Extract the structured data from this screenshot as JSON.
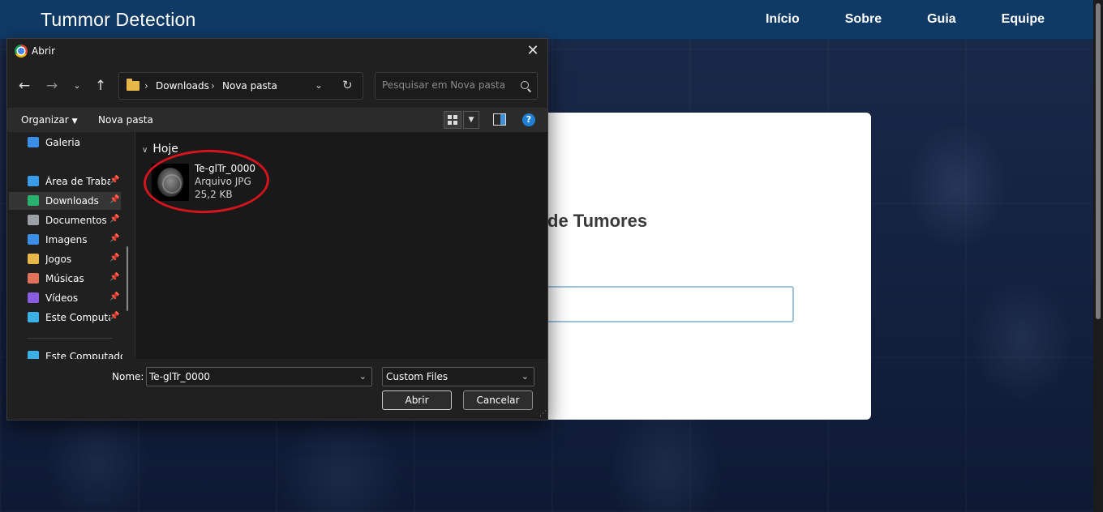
{
  "page": {
    "brand": "Tummor Detection",
    "nav": [
      "Início",
      "Sobre",
      "Guia",
      "Equipe"
    ],
    "card_title": "de Tumores"
  },
  "dialog": {
    "title": "Abrir",
    "breadcrumb": [
      "Downloads",
      "Nova pasta"
    ],
    "search_placeholder": "Pesquisar em Nova pasta",
    "toolbar": {
      "organize": "Organizar",
      "new_folder": "Nova pasta"
    },
    "nav_items": [
      {
        "label": "Galeria",
        "icon": "gallery-icon",
        "pinned": false,
        "color": "#3a8ee6"
      },
      {
        "label": "Área de Trabalho",
        "icon": "desktop-icon",
        "pinned": true,
        "color": "#3a9be8"
      },
      {
        "label": "Downloads",
        "icon": "download-icon",
        "pinned": true,
        "color": "#27b36d"
      },
      {
        "label": "Documentos",
        "icon": "document-icon",
        "pinned": true,
        "color": "#9aa0a6"
      },
      {
        "label": "Imagens",
        "icon": "image-icon",
        "pinned": true,
        "color": "#3a8ee6"
      },
      {
        "label": "Jogos",
        "icon": "folder-icon",
        "pinned": true,
        "color": "#e8b74a"
      },
      {
        "label": "Músicas",
        "icon": "music-icon",
        "pinned": true,
        "color": "#e0725a"
      },
      {
        "label": "Vídeos",
        "icon": "video-icon",
        "pinned": true,
        "color": "#8a5ce0"
      },
      {
        "label": "Este Computador",
        "icon": "computer-icon",
        "pinned": true,
        "color": "#3ab0e6"
      },
      {
        "label": "Este Computador",
        "icon": "computer-icon",
        "pinned": false,
        "color": "#3ab0e6"
      }
    ],
    "selected_nav": "Downloads",
    "group": "Hoje",
    "file": {
      "name": "Te-glTr_0000",
      "type": "Arquivo JPG",
      "size": "25,2 KB"
    },
    "filename_label": "Nome:",
    "filename_value": "Te-glTr_0000",
    "filetype": "Custom Files",
    "open_label": "Abrir",
    "cancel_label": "Cancelar"
  }
}
